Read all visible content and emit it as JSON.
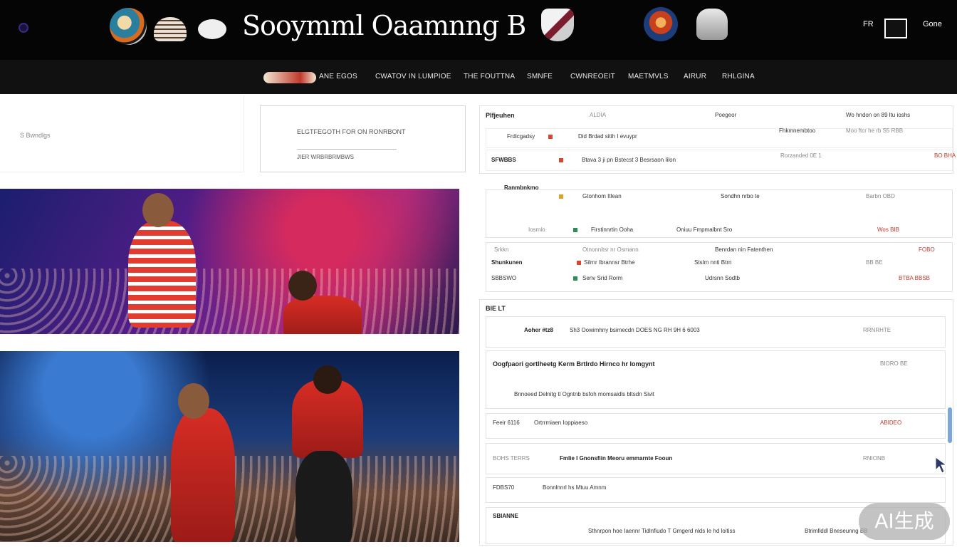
{
  "header": {
    "brand": "Sooymml Oaamnng B",
    "right_link": "FR",
    "right_user": "Gone"
  },
  "nav": {
    "items": [
      "ANE EGOS",
      "CWATOV IN LUMPIOE",
      "THE FOUTTNA",
      "SMNFE",
      "CWNREOEIT",
      "MAETMVLS",
      "AIRUR",
      "RHLGINA"
    ]
  },
  "filters": {
    "left_label": "S Bwndlgs",
    "promo_title": "ELGTFEGOTH FOR ON RONRBONT",
    "promo_sub": "JIER WRBRBRMBWS"
  },
  "results": {
    "header_cols": [
      "Plfjeuhen",
      "ALDIA",
      "Poegeor",
      "Wo hndon on 89 ltu ioshs"
    ],
    "rows": [
      {
        "a": "Frdicgadsy",
        "b": "Did Brdad sitih I evuypr",
        "c": "Fhkmnembtoo",
        "d": "Moo ftcr he rb S5 RBB"
      },
      {
        "a": "SFWBBS",
        "b": "Btava 3 ji pn Bstecst 3 Besrsaon Iilon",
        "c": "Rorzanded 0E 1",
        "d": "BO BHA"
      },
      {
        "a": "Ranmbnkmo",
        "b": "Gtonhom Itlean",
        "c": "Sondhn nrbo te",
        "d": "Barbn OBD"
      },
      {
        "a": "Iosmlo",
        "b": "Firstinnrtin Ooha",
        "c": "Oniuu Fmpmalbnt Sro",
        "d": "Wos BIB"
      },
      {
        "a": "Srkkn",
        "b": "Otnonnitsr nr Osmann",
        "c": "Benrdan nin Fatenthen",
        "d": "FOBO"
      },
      {
        "a": "Shunkunen",
        "b": "Silrnr Ibrannsr Btrhe",
        "c": "Stslrn nnti Btrn",
        "d": "BB BE"
      },
      {
        "a": "SBBSWO",
        "b": "Senv Srid Rorm",
        "c": "Udrsnn Sodtb",
        "d": "BTBA BBSB"
      }
    ]
  },
  "feed": {
    "section_label": "BIE LT",
    "items": [
      {
        "title": "Aoher #tz8",
        "meta": "Sh3 Oowimhny bsimecdn DOES NG RH 9H 6 6003",
        "right": "RRNRHTE"
      },
      {
        "title": "Oogfpaori gortlheetg Kerm Brtlrdo Hirnco hr lomgynt",
        "meta": "Bnnoeed Delnitg tl Ogntnb bsfoh momsaidls bltsdn Sivit",
        "right": "BIORO BE"
      },
      {
        "title": "Feeir 6116",
        "meta": "Ortrrmiaen Ioppiaeso",
        "right": "ABIDEO"
      },
      {
        "title": "BOHS TERRS",
        "meta": "Fmlie I Gnonsfiin Meoru emmarnte Fooun",
        "right": "RNIONB"
      },
      {
        "title": "FDBS70",
        "meta": "Bonnlnnrl hs Mtuu Amnm",
        "right": ""
      },
      {
        "title": "SBIANNE",
        "meta": "Sthnrpon hoe Iaennr Tidlnfiudo T Gmgerd nlds Ie hd loitiss",
        "right": "Btrimllddl Bneseunng BB"
      }
    ]
  },
  "watermark": "AI生成",
  "colors": {
    "header_bg": "#050505",
    "nav_bg": "#111111",
    "accent_red": "#c0392b"
  }
}
